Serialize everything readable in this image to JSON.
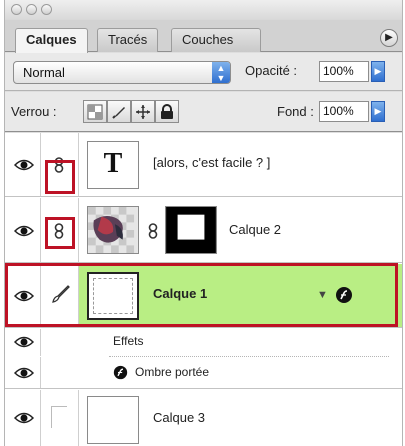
{
  "window": {
    "traffic_lights": [
      "close",
      "minimize",
      "zoom"
    ]
  },
  "tabs": [
    {
      "label": "Calques",
      "active": true
    },
    {
      "label": "Tracés",
      "active": false
    },
    {
      "label": "Couches",
      "active": false
    }
  ],
  "panel_menu_icon": "circle-arrow-right-icon",
  "blend": {
    "mode": "Normal",
    "opacity_label": "Opacité :",
    "opacity_value": "100%"
  },
  "lock": {
    "label": "Verrou :",
    "buttons": [
      "lock-transparency-icon",
      "lock-paint-icon",
      "lock-move-icon",
      "lock-all-icon"
    ],
    "fill_label": "Fond :",
    "fill_value": "100%"
  },
  "layers": [
    {
      "name": "[alors, c'est facile ? ]",
      "type": "text",
      "thumb_letter": "T",
      "visible": true,
      "linked": true
    },
    {
      "name": "Calque 2",
      "type": "image-with-mask",
      "visible": true,
      "linked": true
    },
    {
      "name": "Calque 1",
      "type": "layer",
      "selected": true,
      "visible": true,
      "has_effects": true
    },
    {
      "name": "Effets",
      "type": "effects-group",
      "visible": true
    },
    {
      "name": "Ombre portée",
      "type": "effect",
      "visible": true
    },
    {
      "name": "Calque 3",
      "type": "layer",
      "visible": true
    }
  ],
  "colors": {
    "selected_row": "#b9ee84",
    "highlight_box": "#bd1225",
    "blue_control": "#2f6fd0"
  }
}
